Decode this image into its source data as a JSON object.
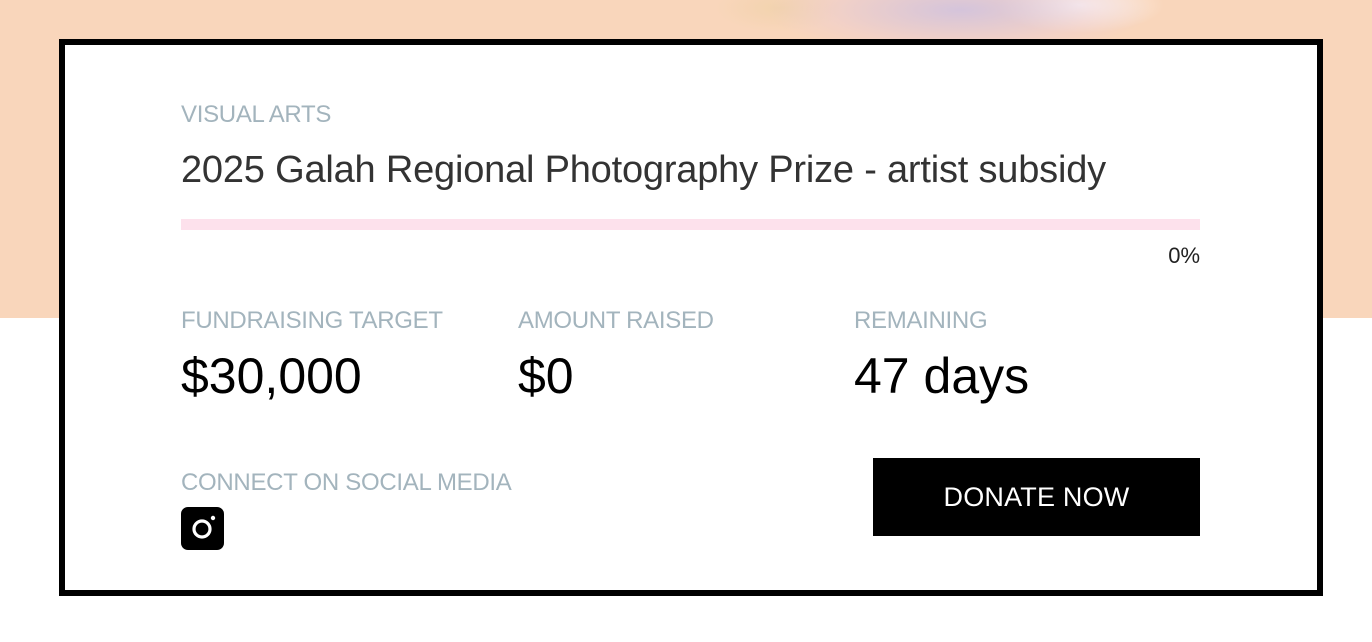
{
  "campaign": {
    "category": "VISUAL ARTS",
    "title": "2025 Galah Regional Photography Prize - artist subsidy",
    "progress_percent": 0,
    "progress_label": "0%"
  },
  "stats": {
    "target": {
      "label": "FUNDRAISING TARGET",
      "value": "$30,000"
    },
    "raised": {
      "label": "AMOUNT RAISED",
      "value": "$0"
    },
    "remaining": {
      "label": "REMAINING",
      "value": "47 days"
    }
  },
  "social": {
    "label": "CONNECT ON SOCIAL MEDIA",
    "icons": [
      "instagram-icon"
    ]
  },
  "actions": {
    "donate_label": "DONATE NOW"
  },
  "colors": {
    "hero_background": "#f9d6bb",
    "card_border": "#000000",
    "label_gray": "#a3b4bd",
    "progress_track": "#fde1ec",
    "button_background": "#000000",
    "button_text": "#ffffff"
  }
}
